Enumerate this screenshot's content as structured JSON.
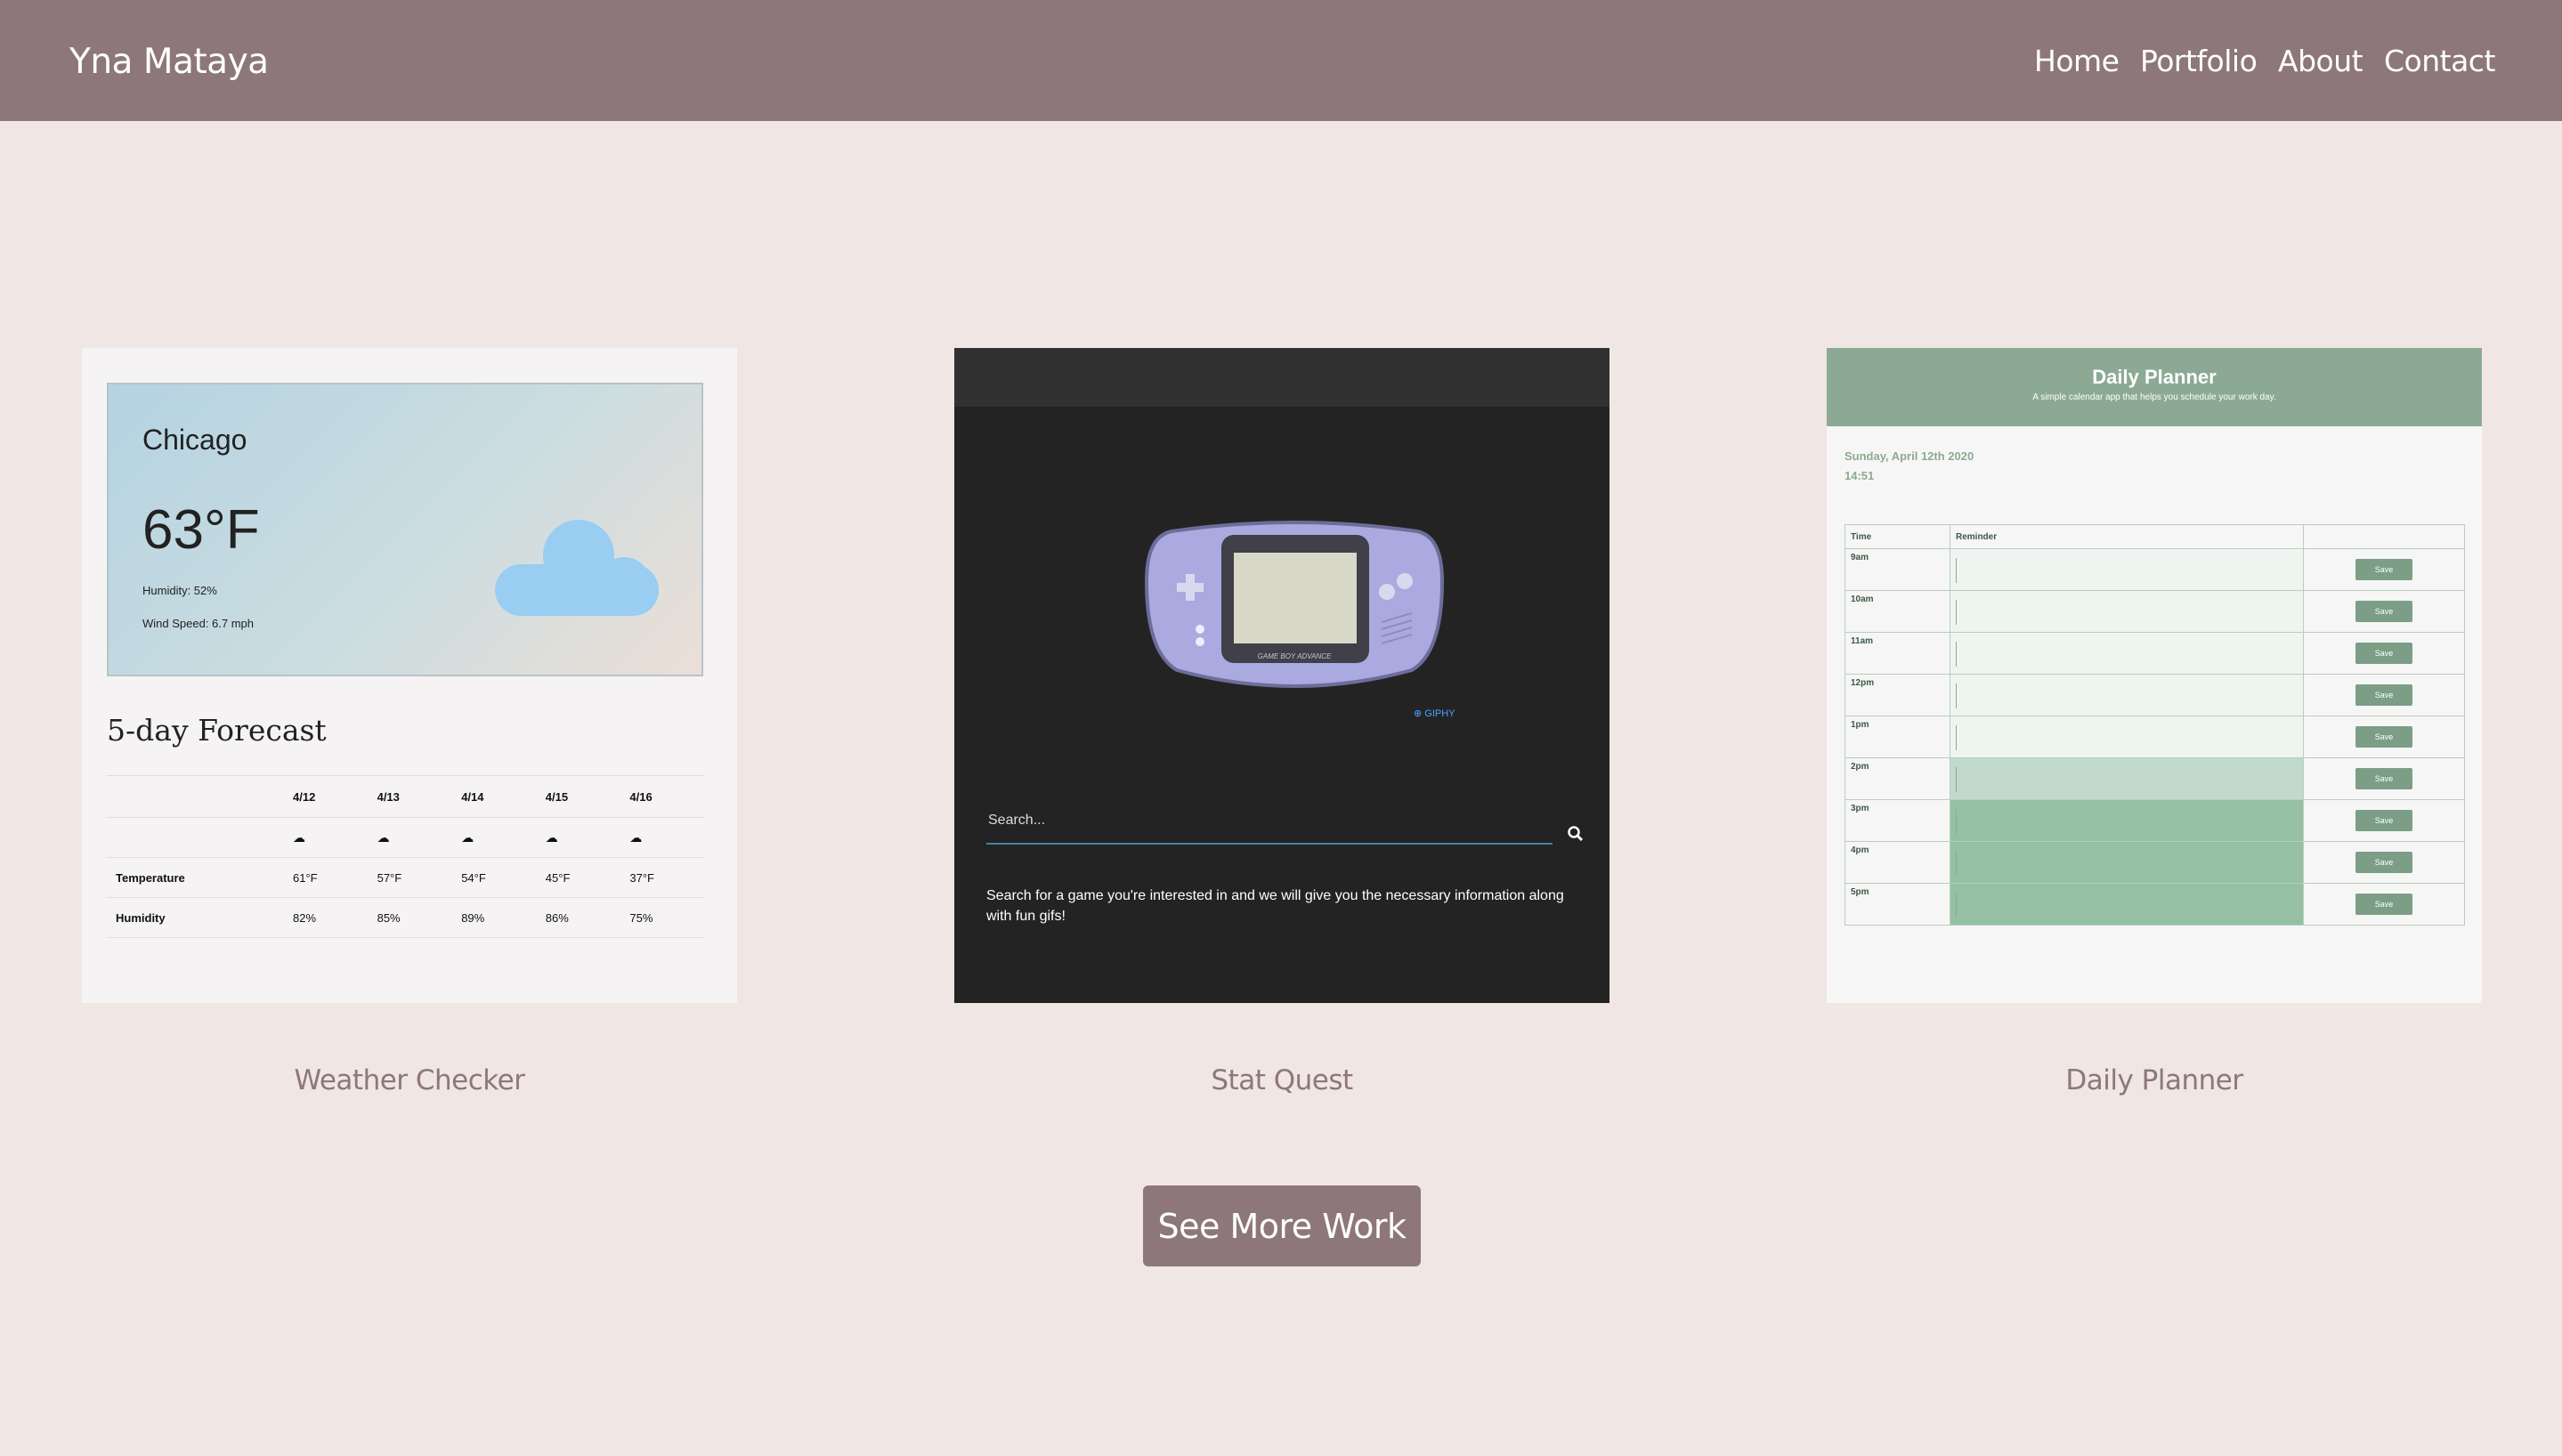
{
  "nav": {
    "brand": "Yna Mataya",
    "links": [
      "Home",
      "Portfolio",
      "About",
      "Contact"
    ]
  },
  "projects": [
    {
      "title": "Weather Checker",
      "preview": {
        "city": "Chicago",
        "temp": "63°F",
        "humidity": "Humidity: 52%",
        "wind": "Wind Speed: 6.7 mph",
        "forecast_title": "5-day Forecast",
        "dates": [
          "4/12",
          "4/13",
          "4/14",
          "4/15",
          "4/16"
        ],
        "row_temperature_label": "Temperature",
        "temperatures": [
          "61°F",
          "57°F",
          "54°F",
          "45°F",
          "37°F"
        ],
        "row_humidity_label": "Humidity",
        "humidities": [
          "82%",
          "85%",
          "89%",
          "86%",
          "75%"
        ]
      }
    },
    {
      "title": "Stat Quest",
      "preview": {
        "search_placeholder": "Search...",
        "description": "Search for a game you're interested in and we will give you the necessary information along with fun gifs!",
        "giphy": "GIPHY",
        "console_label": "GAME BOY ADVANCE"
      }
    },
    {
      "title": "Daily Planner",
      "preview": {
        "title": "Daily Planner",
        "subtitle": "A simple calendar app that helps you schedule your work day.",
        "date": "Sunday, April 12th 2020",
        "time": "14:51",
        "col_time": "Time",
        "col_reminder": "Reminder",
        "save_label": "Save",
        "hours": [
          "9am",
          "10am",
          "11am",
          "12pm",
          "1pm",
          "2pm",
          "3pm",
          "4pm",
          "5pm"
        ],
        "hour_states": [
          "past",
          "past",
          "past",
          "past",
          "past",
          "present",
          "future",
          "future",
          "future"
        ]
      }
    }
  ],
  "see_more_label": "See More Work",
  "colors": {
    "nav_bg": "#8d777b",
    "page_bg": "#f0e6e4",
    "planner_past": "#eef5f1",
    "planner_present": "#c2dacb",
    "planner_future": "#95c0a4"
  }
}
